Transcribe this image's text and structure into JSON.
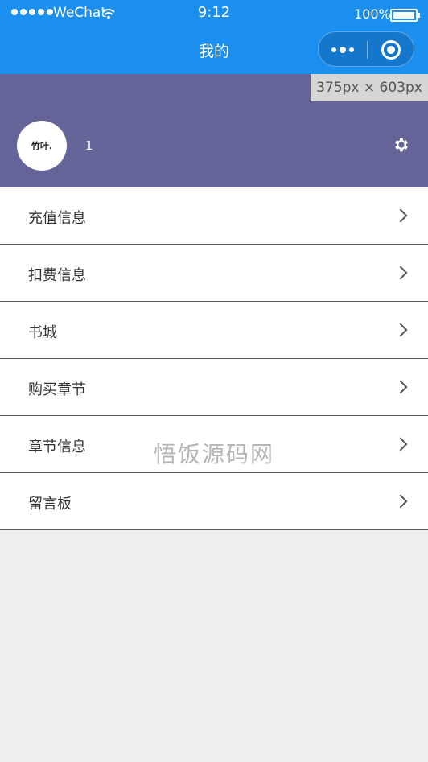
{
  "status_bar": {
    "carrier": "WeChat",
    "time": "9:12",
    "battery": "100%"
  },
  "nav": {
    "title": "我的"
  },
  "dimension_badge": "375px × 603px",
  "profile": {
    "avatar_text": "竹叶.",
    "username": "1"
  },
  "menu": [
    {
      "label": "充值信息"
    },
    {
      "label": "扣费信息"
    },
    {
      "label": "书城"
    },
    {
      "label": "购买章节"
    },
    {
      "label": "章节信息"
    },
    {
      "label": "留言板"
    }
  ],
  "watermark": "悟饭源码网",
  "colors": {
    "nav_blue": "#1a8ff0",
    "profile_purple": "#656498",
    "page_bg": "#efefef"
  }
}
